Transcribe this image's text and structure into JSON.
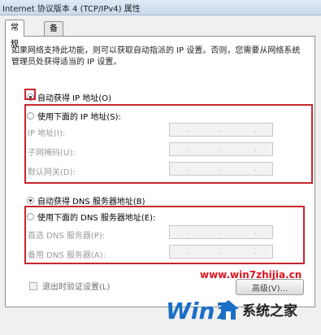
{
  "window": {
    "title": "Internet 协议版本 4 (TCP/IPv4) 属性"
  },
  "tabs": [
    {
      "label": "常规"
    },
    {
      "label": "备用配置"
    }
  ],
  "description": "如果网络支持此功能，则可以获取自动指派的 IP 设置。否则，您需要从网络系统管理员处获得适当的 IP 设置。",
  "ip": {
    "auto_label": "自动获得 IP 地址(O)",
    "manual_label": "使用下面的 IP 地址(S):",
    "fields": [
      {
        "label": "IP 地址(I):"
      },
      {
        "label": "子网掩码(U):"
      },
      {
        "label": "默认网关(D):"
      }
    ],
    "selected": "auto"
  },
  "dns": {
    "auto_label": "自动获得 DNS 服务器地址(B)",
    "manual_label": "使用下面的 DNS 服务器地址(E):",
    "fields": [
      {
        "label": "首选 DNS 服务器(P):"
      },
      {
        "label": "备用 DNS 服务器(A):"
      }
    ],
    "selected": "auto"
  },
  "validate_label": "退出时验证设置(L)",
  "advanced_label": "高级(V)...",
  "watermark": {
    "url": "www.win7zhijia.cn",
    "logo_text": "Win7",
    "brand": "系统之家"
  },
  "colors": {
    "highlight_box": "#c8272e",
    "watermark_url": "#e0141e",
    "logo_blue": "#1a6fc4"
  }
}
